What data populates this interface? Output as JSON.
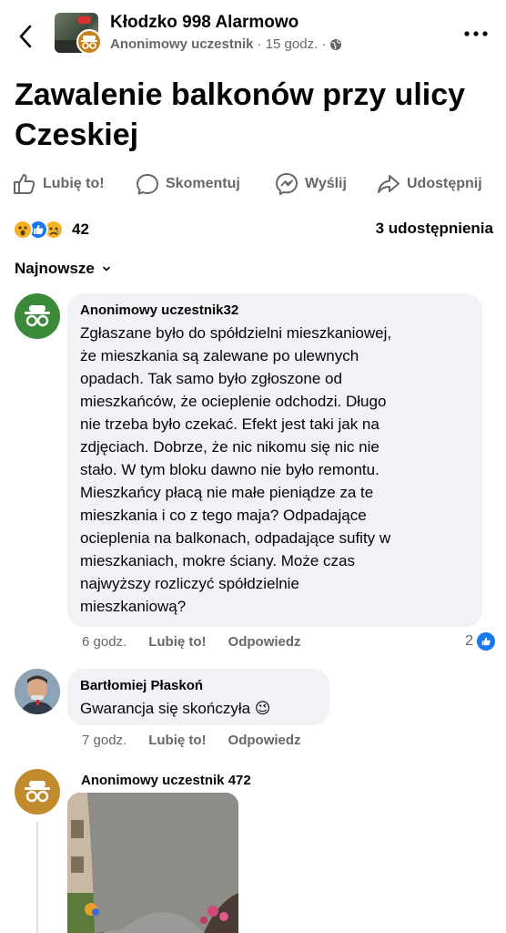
{
  "header": {
    "group_name": "Kłodzko 998 Alarmowo",
    "author": "Anonimowy uczestnik",
    "time": "· 15 godz. ·"
  },
  "post": {
    "title": "Zawalenie balkonów przy ulicy Czeskiej"
  },
  "actions": {
    "like": "Lubię to!",
    "comment": "Skomentuj",
    "send": "Wyślij",
    "share": "Udostępnij"
  },
  "stats": {
    "reaction_count": "42",
    "shares": "3 udostępnienia"
  },
  "sort": {
    "label": "Najnowsze"
  },
  "comments": [
    {
      "author": "Anonimowy uczestnik32",
      "text": "Zgłaszane było  do spółdzielni mieszkaniowej,\nże mieszkania są zalewane po ulewnych\nopadach. Tak samo było zgłoszone od\nmieszkańców, że ocieplenie odchodzi. Długo\nnie trzeba było czekać.  Efekt jest taki jak na\nzdjęciach. Dobrze, że nic nikomu się nic nie\nstało. W tym bloku dawno nie było remontu.\nMieszkańcy płacą nie małe pieniądze za te\nmieszkania i co z tego maja? Odpadające\nocieplenia na balkonach, odpadające sufity w\nmieszkaniach, mokre ściany. Może czas\nnajwyższy rozliczyć spółdzielnie\nmieszkaniową?",
      "time": "6 godz.",
      "like": "Lubię to!",
      "reply": "Odpowiedz",
      "likes": "2"
    },
    {
      "author": "Bartłomiej Płaskoń",
      "text": "Gwarancja się skończyła 😉",
      "time": "7 godz.",
      "like": "Lubię to!",
      "reply": "Odpowiedz"
    },
    {
      "author": "Anonimowy uczestnik 472"
    }
  ],
  "colors": {
    "secondary_text": "#65676b",
    "bubble": "#f0f2f5",
    "accent_blue": "#1877f2"
  }
}
